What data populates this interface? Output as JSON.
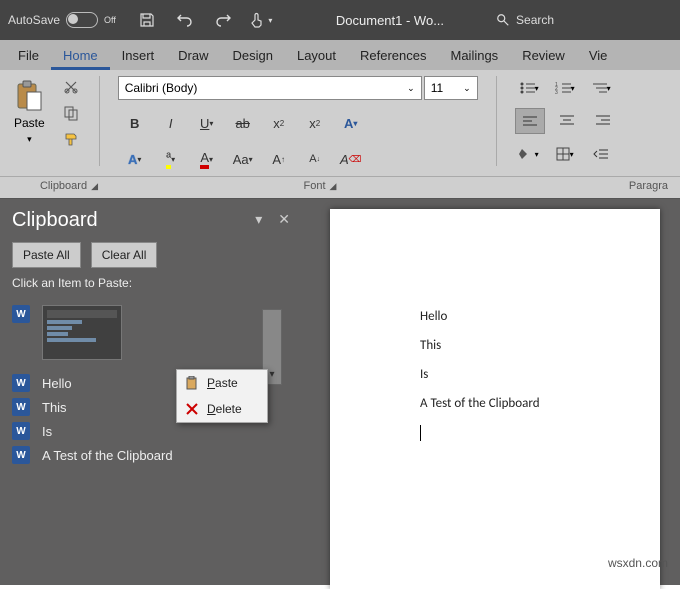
{
  "titlebar": {
    "autosave_label": "AutoSave",
    "autosave_state": "Off",
    "document_title": "Document1 - Wo...",
    "search_label": "Search"
  },
  "tabs": {
    "file": "File",
    "home": "Home",
    "insert": "Insert",
    "draw": "Draw",
    "design": "Design",
    "layout": "Layout",
    "references": "References",
    "mailings": "Mailings",
    "review": "Review",
    "view": "Vie"
  },
  "ribbon": {
    "paste_label": "Paste",
    "font_name": "Calibri (Body)",
    "font_size": "11",
    "group_clipboard": "Clipboard",
    "group_font": "Font",
    "group_paragraph": "Paragra"
  },
  "clipboard_pane": {
    "title": "Clipboard",
    "paste_all": "Paste All",
    "clear_all": "Clear All",
    "hint": "Click an Item to Paste:",
    "items": {
      "0": "Hello",
      "1": "This",
      "2": "Is",
      "3": "A Test of the Clipboard"
    },
    "ctx_paste": "Paste",
    "ctx_delete": "Delete"
  },
  "document": {
    "lines": {
      "0": "Hello",
      "1": "This",
      "2": "Is",
      "3": "A Test of the Clipboard"
    }
  },
  "watermark": "wsxdn.com"
}
